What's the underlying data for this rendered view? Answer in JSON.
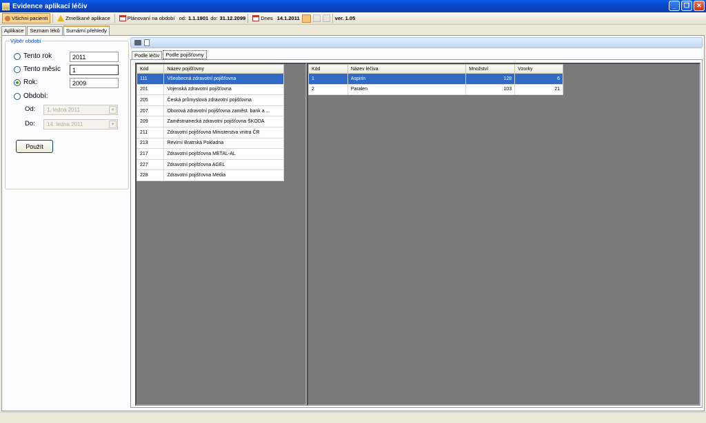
{
  "window": {
    "title": "Evidence aplikací léčiv"
  },
  "toolbar": {
    "all_patients": "Všichni pacienti",
    "missed": "Zmeškané aplikace",
    "planning_label": "Plánovaní na období",
    "from_label": "od:",
    "from_value": "1.1.1901",
    "to_label": "do:",
    "to_value": "31.12.2099",
    "today_label": "Dnes",
    "today_value": "14.1.2011",
    "version": "ver. 1.05"
  },
  "main_tabs": [
    "Aplikace",
    "Seznam léků",
    "Sumární přehledy"
  ],
  "period": {
    "group_title": "Výběr období",
    "this_year_label": "Tento rok",
    "this_year_value": "2011",
    "this_month_label": "Tento měsíc",
    "this_month_value": "1",
    "year_label": "Rok:",
    "year_value": "2009",
    "range_label": "Období:",
    "from_label": "Od:",
    "from_value": "1.   ledna   2011",
    "to_label": "Do:",
    "to_value": "14.  ledna   2011",
    "apply_button": "Použít"
  },
  "sub_tabs": [
    "Podle léčiv",
    "Podle pojišťovny"
  ],
  "insurers": {
    "headers": [
      "Kód",
      "Název pojišťovny"
    ],
    "rows": [
      [
        "111",
        "Všeobecná zdravotní pojišťovna"
      ],
      [
        "201",
        "Vojenská zdravotní pojišťovna"
      ],
      [
        "205",
        "Česká průmyslová zdravotní pojišťovna"
      ],
      [
        "207",
        "Oborová zdravotní pojišťovna zaměst. bank a ..."
      ],
      [
        "209",
        "Zaměstnanecká zdravotní pojišťovna ŠKODA"
      ],
      [
        "211",
        "Zdravotní pojišťovna Ministerstva vnitra ČR"
      ],
      [
        "213",
        "Revírní Bratrská Pokladna"
      ],
      [
        "217",
        "Zdravotní pojišťovna METAL-AL"
      ],
      [
        "227",
        "Zdravotní pojišťovna AGEL"
      ],
      [
        "228",
        "Zdravotní pojišťovna Média"
      ]
    ]
  },
  "drugs": {
    "headers": [
      "Kód",
      "Název léčiva",
      "Množství",
      "Vzorky"
    ],
    "rows": [
      [
        "1",
        "Aspirin",
        "128",
        "6"
      ],
      [
        "2",
        "Paralen",
        "103",
        "21"
      ]
    ]
  }
}
